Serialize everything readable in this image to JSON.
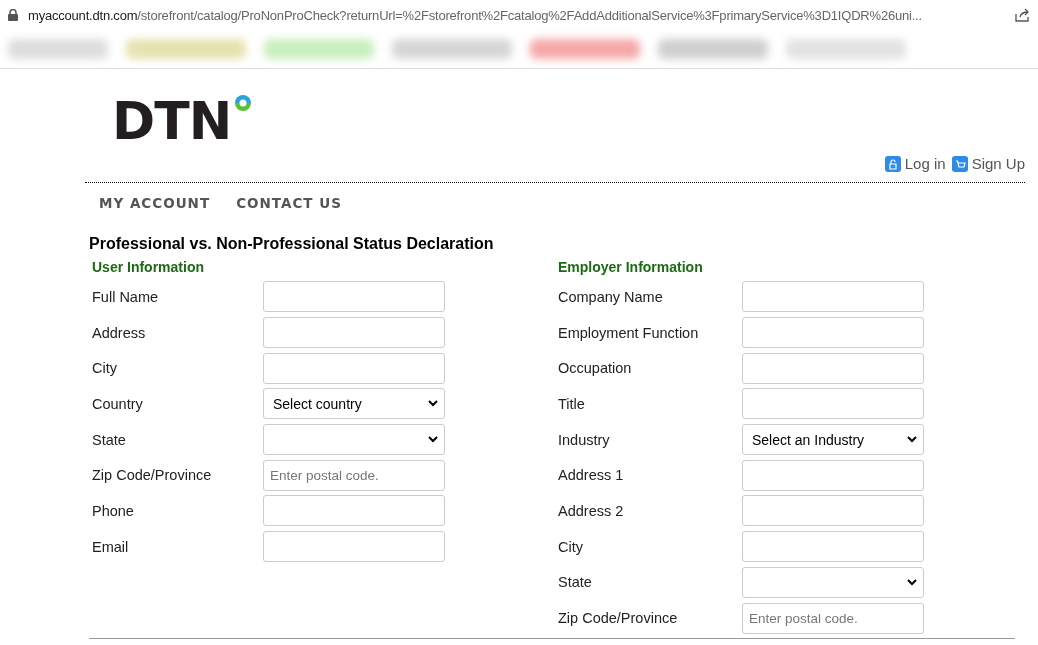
{
  "browser": {
    "url_host": "myaccount.dtn.com",
    "url_path": "/storefront/catalog/ProNonProCheck?returnUrl=%2Fstorefront%2Fcatalog%2FAddAdditionalService%3FprimaryService%3D1IQDR%26uni..."
  },
  "header": {
    "logo": "DTN",
    "links": [
      {
        "label": "Log in",
        "kind": "login"
      },
      {
        "label": "Sign Up",
        "kind": "signup"
      }
    ]
  },
  "nav": [
    "MY ACCOUNT",
    "CONTACT US"
  ],
  "title": "Professional vs. Non-Professional Status Declaration",
  "sections": [
    {
      "heading": "User Information",
      "fields": [
        {
          "label": "Full Name",
          "kind": "text"
        },
        {
          "label": "Address",
          "kind": "text"
        },
        {
          "label": "City",
          "kind": "text"
        },
        {
          "label": "Country",
          "kind": "select",
          "value": "Select country"
        },
        {
          "label": "State",
          "kind": "select"
        },
        {
          "label": "Zip Code/Province",
          "kind": "text",
          "placeholder": "Enter postal code."
        },
        {
          "label": "Phone",
          "kind": "text"
        },
        {
          "label": "Email",
          "kind": "text"
        }
      ]
    },
    {
      "heading": "Employer Information",
      "fields": [
        {
          "label": "Company Name",
          "kind": "text"
        },
        {
          "label": "Employment Function",
          "kind": "text"
        },
        {
          "label": "Occupation",
          "kind": "text"
        },
        {
          "label": "Title",
          "kind": "text"
        },
        {
          "label": "Industry",
          "kind": "select",
          "value": "Select an Industry"
        },
        {
          "label": "Address 1",
          "kind": "text"
        },
        {
          "label": "Address 2",
          "kind": "text"
        },
        {
          "label": "City",
          "kind": "text"
        },
        {
          "label": "State",
          "kind": "select"
        },
        {
          "label": "Zip Code/Province",
          "kind": "text",
          "placeholder": "Enter postal code."
        }
      ]
    }
  ]
}
